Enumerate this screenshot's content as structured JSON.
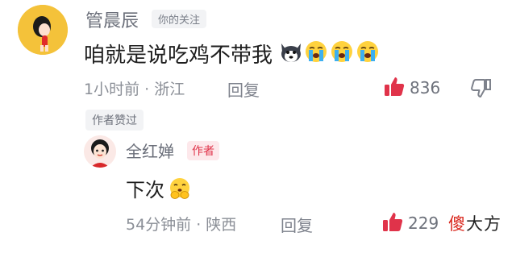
{
  "main_comment": {
    "username": "管晨辰",
    "follow_badge": "你的关注",
    "text": "咱就是说吃鸡不带我",
    "emojis": [
      "husky-icon",
      "crying-face-icon",
      "crying-face-icon",
      "crying-face-icon"
    ],
    "time_location": "1小时前 · 浙江",
    "reply_label": "回复",
    "like_count": "836"
  },
  "author_liked_label": "作者赞过",
  "reply_comment": {
    "username": "全红婵",
    "author_badge": "作者",
    "text": "下次",
    "emoji": "pleading-hands-icon",
    "time_location": "54分钟前 · 陕西",
    "reply_label": "回复",
    "like_count": "229"
  },
  "watermark": {
    "part1": "傻",
    "part2": "大方"
  },
  "colors": {
    "like_red": "#e0334a",
    "badge_red": "#e0334a",
    "avatar_yellow": "#f4c23a",
    "emoji_blue": "#3db0f0"
  }
}
